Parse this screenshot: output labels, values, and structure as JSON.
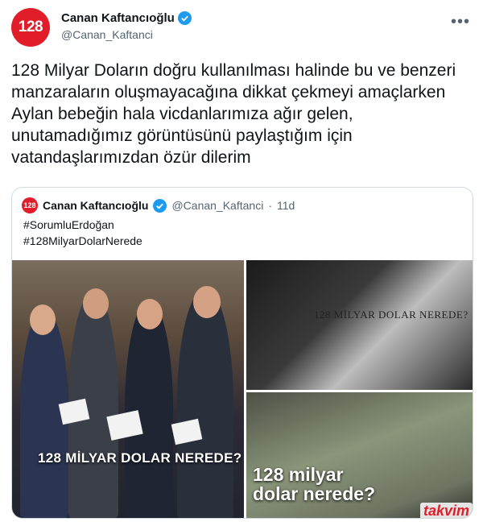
{
  "tweet": {
    "author": {
      "avatar_text": "128",
      "display_name": "Canan Kaftancıoğlu",
      "handle": "@Canan_Kaftanci",
      "verified": true
    },
    "more_icon": "more-horizontal-icon",
    "text": "128 Milyar Doların doğru kullanılması halinde bu ve benzeri manzaraların oluşmayacağına dikkat çekmeyi amaçlarken Aylan bebeğin hala vicdanlarımıza ağır gelen, unutamadığımız görüntüsünü paylaştığım için vatandaşlarımızdan özür dilerim"
  },
  "quoted_tweet": {
    "avatar_text": "128",
    "display_name": "Canan Kaftancıoğlu",
    "handle": "@Canan_Kaftanci",
    "separator": "·",
    "time": "11d",
    "hashtags": [
      "#SorumluErdoğan",
      "#128MilyarDolarNerede"
    ],
    "images": [
      {
        "caption": "128 MİLYAR DOLAR NEREDE?"
      },
      {
        "caption": "128 MİLYAR DOLAR NEREDE?"
      },
      {
        "caption_line1": "128 milyar",
        "caption_line2": "dolar nerede?"
      }
    ]
  },
  "watermark": "takvim",
  "colors": {
    "brand_red": "#e11d2a",
    "verified_blue": "#1d9bf0",
    "muted_text": "#536471",
    "border": "#cfd9de"
  }
}
